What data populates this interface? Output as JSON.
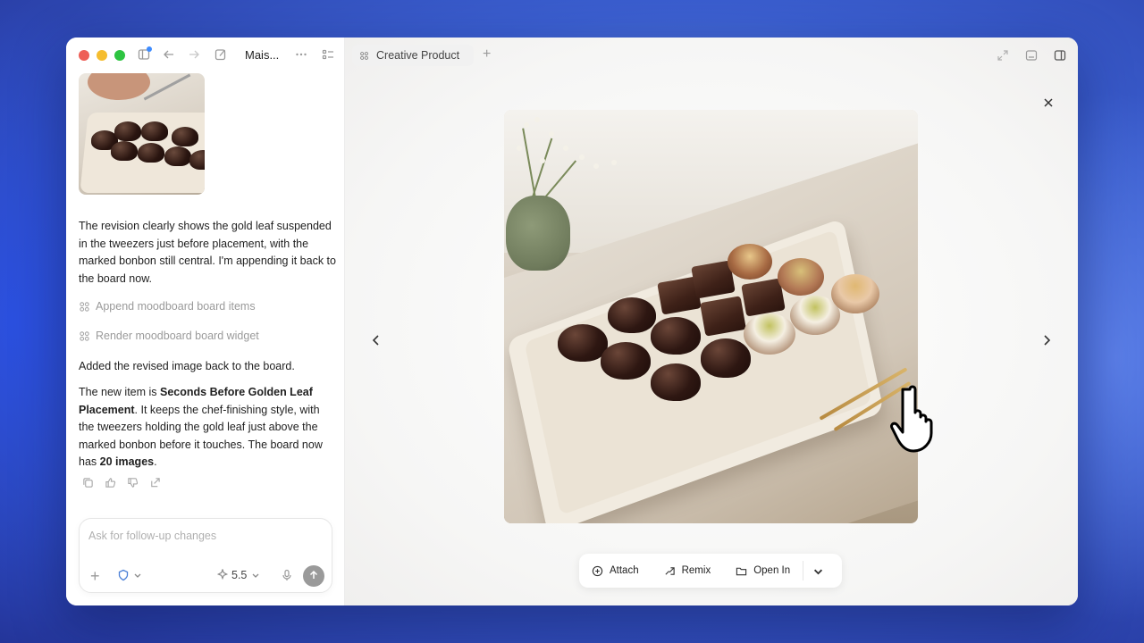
{
  "window": {
    "chat_title": "Mais...",
    "tab_label": "Creative Product"
  },
  "chat": {
    "revision_message": "The revision clearly shows the gold leaf suspended in the tweezers just before placement, with the marked bonbon still central. I'm appending it back to the board now.",
    "tool_steps": [
      {
        "label": "Append moodboard board items",
        "icon": "grid-icon"
      },
      {
        "label": "Render moodboard board widget",
        "icon": "grid-icon"
      }
    ],
    "added_message": "Added the revised image back to the board.",
    "summary": {
      "prefix": "The new item is ",
      "item_name": "Seconds Before Golden Leaf Placement",
      "middle": ". It keeps the chef-finishing style, with the tweezers holding the gold leaf just above the marked bonbon before it touches. The board now has ",
      "count": "20 images",
      "suffix": "."
    },
    "feedback_icons": [
      "copy-icon",
      "thumbs-up-icon",
      "thumbs-down-icon",
      "share-icon"
    ]
  },
  "composer": {
    "placeholder": "Ask for follow-up changes",
    "model_label": "5.5"
  },
  "viewer": {
    "actions": [
      {
        "label": "Attach",
        "icon": "paperclip-plus-icon"
      },
      {
        "label": "Remix",
        "icon": "remix-icon"
      },
      {
        "label": "Open In",
        "icon": "folder-icon"
      }
    ]
  },
  "colors": {
    "traffic_red": "#ee5f57",
    "traffic_yellow": "#f5bd2f",
    "traffic_green": "#2dc441",
    "accent_blue": "#3d8bff"
  }
}
